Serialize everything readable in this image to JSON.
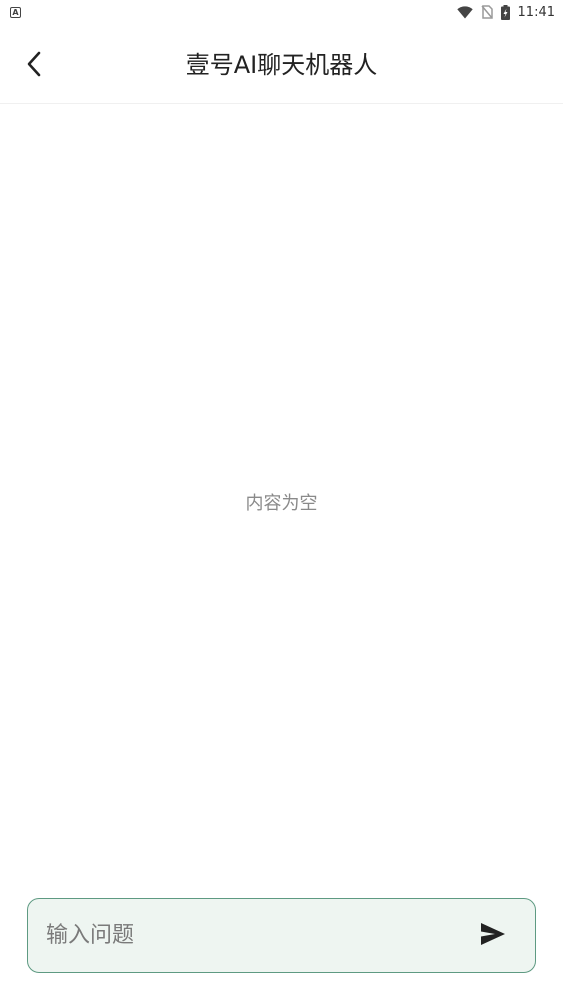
{
  "status_bar": {
    "app_indicator": "A",
    "time": "11:41",
    "icons": [
      "wifi-icon",
      "no-sim-icon",
      "battery-charging-icon"
    ]
  },
  "app_bar": {
    "title": "壹号AI聊天机器人",
    "back_icon": "chevron-left-icon"
  },
  "content": {
    "empty_text": "内容为空"
  },
  "input": {
    "placeholder": "输入问题",
    "value": "",
    "send_icon": "send-icon"
  },
  "colors": {
    "input_border": "#5e9a82",
    "input_background": "#eef5f1",
    "empty_text": "#8a8a8a"
  }
}
